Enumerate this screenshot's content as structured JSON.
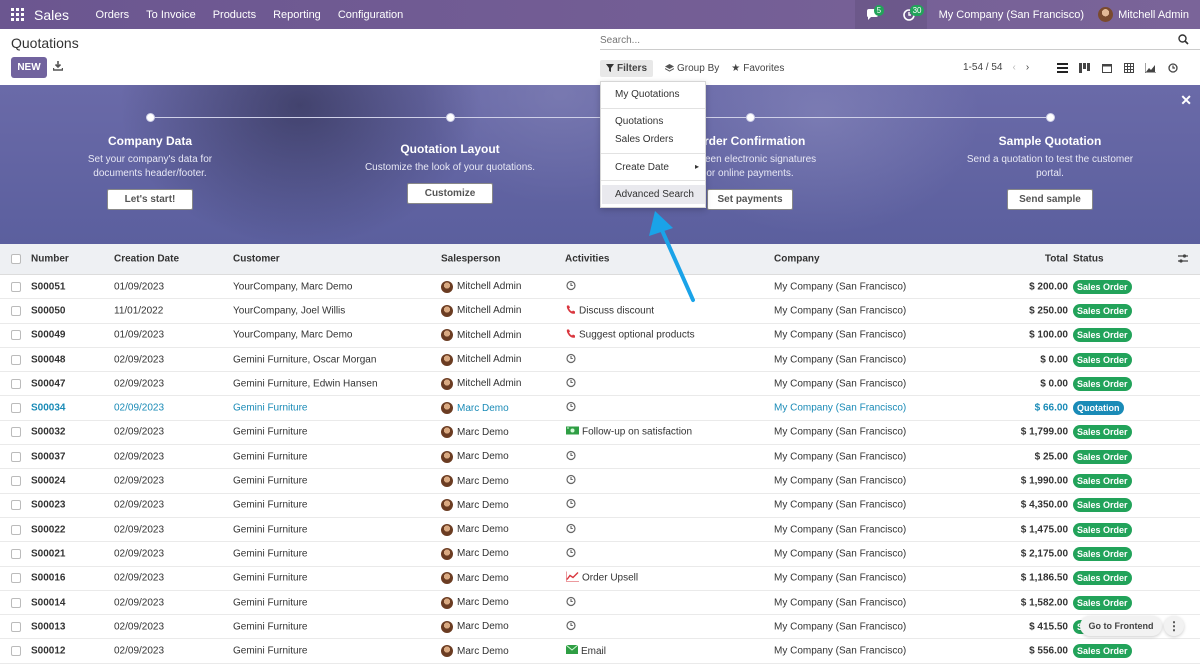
{
  "navbar": {
    "brand": "Sales",
    "menu": [
      "Orders",
      "To Invoice",
      "Products",
      "Reporting",
      "Configuration"
    ],
    "messages_count": "5",
    "activities_count": "30",
    "company": "My Company (San Francisco)",
    "user": "Mitchell Admin"
  },
  "control": {
    "title": "Quotations",
    "search_placeholder": "Search...",
    "new_label": "NEW",
    "filters_label": "Filters",
    "groupby_label": "Group By",
    "favorites_label": "Favorites",
    "pager": "1-54 / 54"
  },
  "filters_menu": {
    "my_quotations": "My Quotations",
    "quotations": "Quotations",
    "sales_orders": "Sales Orders",
    "create_date": "Create Date",
    "advanced_search": "Advanced Search"
  },
  "banner": {
    "steps": [
      {
        "title": "Company Data",
        "text1": "Set your company's data for",
        "text2": "documents header/footer.",
        "button": "Let's start!"
      },
      {
        "title": "Quotation Layout",
        "text1": "Customize the look of your quotations.",
        "text2": "",
        "button": "Customize"
      },
      {
        "title": "Order Confirmation",
        "text1": "between electronic signatures",
        "text2": "or online payments.",
        "button": "Set payments"
      },
      {
        "title": "Sample Quotation",
        "text1": "Send a quotation to test the customer",
        "text2": "portal.",
        "button": "Send sample"
      }
    ]
  },
  "table": {
    "headers": {
      "number": "Number",
      "date": "Creation Date",
      "customer": "Customer",
      "salesperson": "Salesperson",
      "activities": "Activities",
      "company": "Company",
      "total": "Total",
      "status": "Status"
    },
    "rows": [
      {
        "number": "S00051",
        "date": "01/09/2023",
        "customer": "YourCompany, Marc Demo",
        "salesperson": "Mitchell Admin",
        "activity": "",
        "activity_icon": "clock",
        "company": "My Company (San Francisco)",
        "total": "$ 200.00",
        "status": "Sales Order"
      },
      {
        "number": "S00050",
        "date": "11/01/2022",
        "customer": "YourCompany, Joel Willis",
        "salesperson": "Mitchell Admin",
        "activity": "Discuss discount",
        "activity_icon": "phone",
        "company": "My Company (San Francisco)",
        "total": "$ 250.00",
        "status": "Sales Order"
      },
      {
        "number": "S00049",
        "date": "01/09/2023",
        "customer": "YourCompany, Marc Demo",
        "salesperson": "Mitchell Admin",
        "activity": "Suggest optional products",
        "activity_icon": "phone",
        "company": "My Company (San Francisco)",
        "total": "$ 100.00",
        "status": "Sales Order"
      },
      {
        "number": "S00048",
        "date": "02/09/2023",
        "customer": "Gemini Furniture, Oscar Morgan",
        "salesperson": "Mitchell Admin",
        "activity": "",
        "activity_icon": "clock",
        "company": "My Company (San Francisco)",
        "total": "$ 0.00",
        "status": "Sales Order"
      },
      {
        "number": "S00047",
        "date": "02/09/2023",
        "customer": "Gemini Furniture, Edwin Hansen",
        "salesperson": "Mitchell Admin",
        "activity": "",
        "activity_icon": "clock",
        "company": "My Company (San Francisco)",
        "total": "$ 0.00",
        "status": "Sales Order"
      },
      {
        "number": "S00034",
        "date": "02/09/2023",
        "customer": "Gemini Furniture",
        "salesperson": "Marc Demo",
        "activity": "",
        "activity_icon": "clock",
        "company": "My Company (San Francisco)",
        "total": "$ 66.00",
        "status": "Quotation"
      },
      {
        "number": "S00032",
        "date": "02/09/2023",
        "customer": "Gemini Furniture",
        "salesperson": "Marc Demo",
        "activity": "Follow-up on satisfaction",
        "activity_icon": "money",
        "company": "My Company (San Francisco)",
        "total": "$ 1,799.00",
        "status": "Sales Order"
      },
      {
        "number": "S00037",
        "date": "02/09/2023",
        "customer": "Gemini Furniture",
        "salesperson": "Marc Demo",
        "activity": "",
        "activity_icon": "clock",
        "company": "My Company (San Francisco)",
        "total": "$ 25.00",
        "status": "Sales Order"
      },
      {
        "number": "S00024",
        "date": "02/09/2023",
        "customer": "Gemini Furniture",
        "salesperson": "Marc Demo",
        "activity": "",
        "activity_icon": "clock",
        "company": "My Company (San Francisco)",
        "total": "$ 1,990.00",
        "status": "Sales Order"
      },
      {
        "number": "S00023",
        "date": "02/09/2023",
        "customer": "Gemini Furniture",
        "salesperson": "Marc Demo",
        "activity": "",
        "activity_icon": "clock",
        "company": "My Company (San Francisco)",
        "total": "$ 4,350.00",
        "status": "Sales Order"
      },
      {
        "number": "S00022",
        "date": "02/09/2023",
        "customer": "Gemini Furniture",
        "salesperson": "Marc Demo",
        "activity": "",
        "activity_icon": "clock",
        "company": "My Company (San Francisco)",
        "total": "$ 1,475.00",
        "status": "Sales Order"
      },
      {
        "number": "S00021",
        "date": "02/09/2023",
        "customer": "Gemini Furniture",
        "salesperson": "Marc Demo",
        "activity": "",
        "activity_icon": "clock",
        "company": "My Company (San Francisco)",
        "total": "$ 2,175.00",
        "status": "Sales Order"
      },
      {
        "number": "S00016",
        "date": "02/09/2023",
        "customer": "Gemini Furniture",
        "salesperson": "Marc Demo",
        "activity": "Order Upsell",
        "activity_icon": "chart",
        "company": "My Company (San Francisco)",
        "total": "$ 1,186.50",
        "status": "Sales Order"
      },
      {
        "number": "S00014",
        "date": "02/09/2023",
        "customer": "Gemini Furniture",
        "salesperson": "Marc Demo",
        "activity": "",
        "activity_icon": "clock",
        "company": "My Company (San Francisco)",
        "total": "$ 1,582.00",
        "status": "Sales Order"
      },
      {
        "number": "S00013",
        "date": "02/09/2023",
        "customer": "Gemini Furniture",
        "salesperson": "Marc Demo",
        "activity": "",
        "activity_icon": "clock",
        "company": "My Company (San Francisco)",
        "total": "$ 415.50",
        "status": "Sales Order"
      },
      {
        "number": "S00012",
        "date": "02/09/2023",
        "customer": "Gemini Furniture",
        "salesperson": "Marc Demo",
        "activity": "Email",
        "activity_icon": "email",
        "company": "My Company (San Francisco)",
        "total": "$ 556.00",
        "status": "Sales Order"
      }
    ]
  },
  "floating": {
    "frontend_label": "Go to Frontend"
  },
  "colors": {
    "navbar": "#705a8f",
    "primary": "#71639e",
    "success": "#22a35a",
    "info": "#1a8bb7",
    "pointer": "#1aa3e8"
  }
}
